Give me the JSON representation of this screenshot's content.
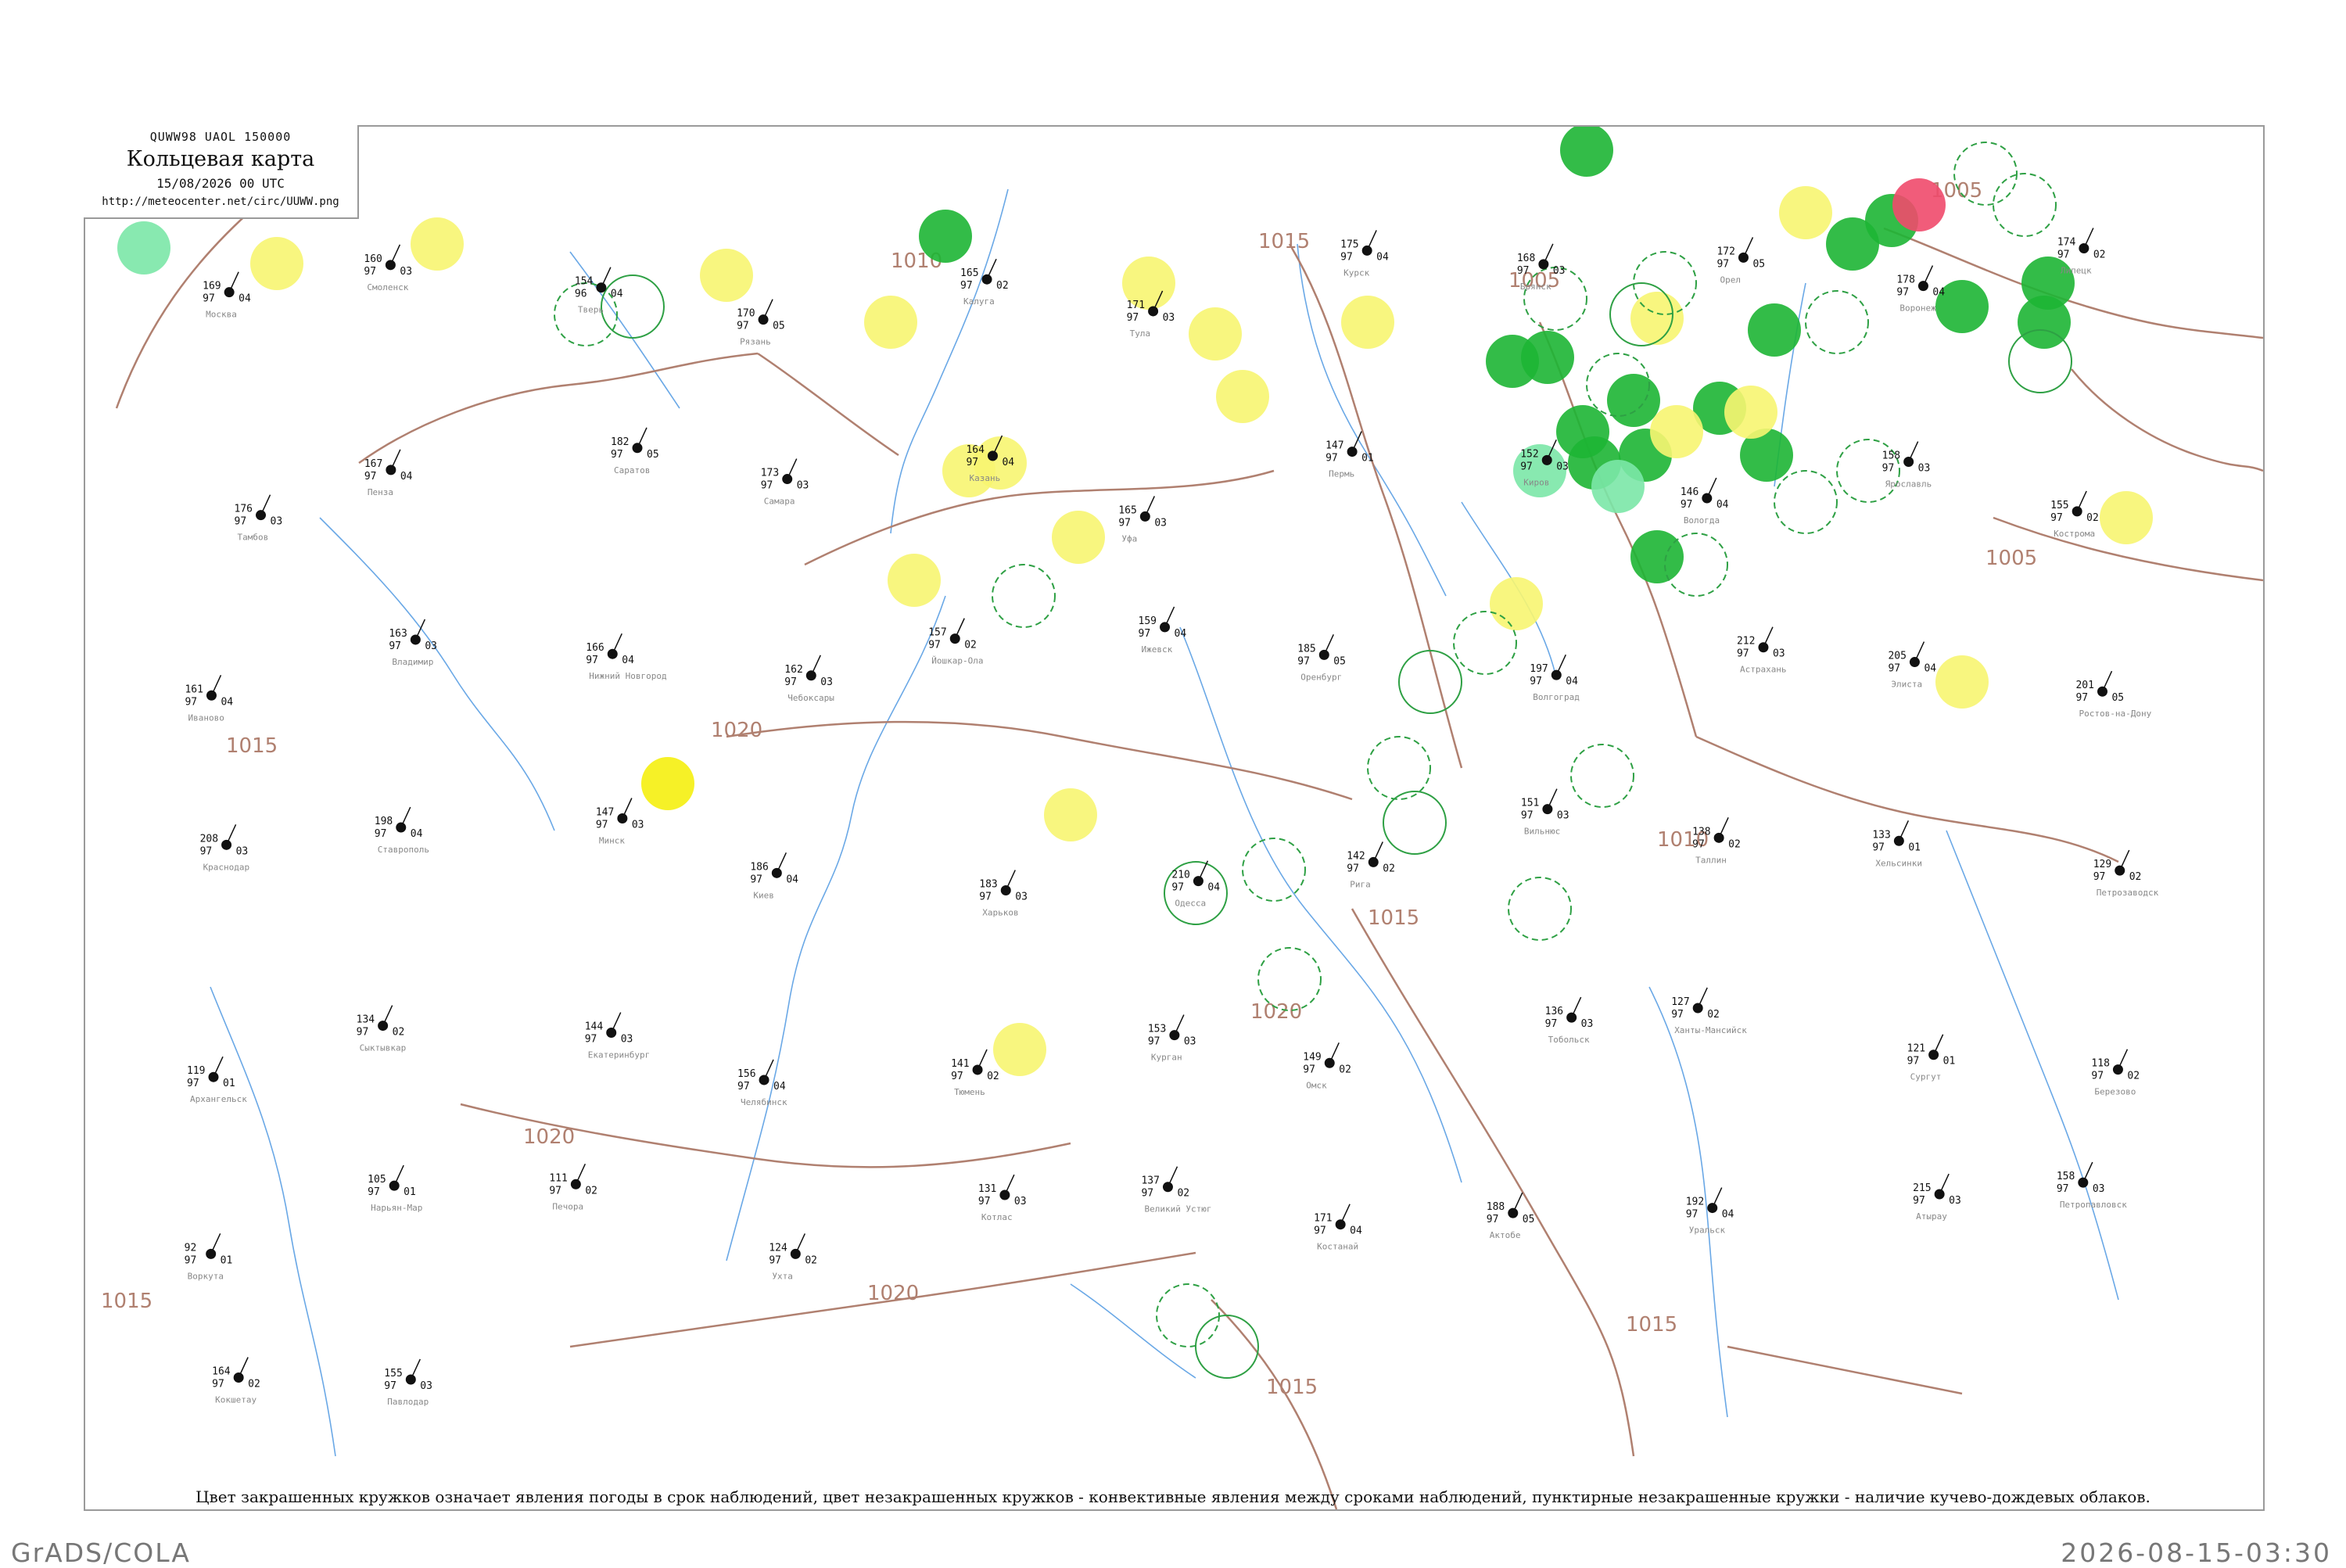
{
  "header": {
    "code": "QUWW98  UAOL  150000",
    "title": "Кольцевая карта",
    "date": "15/08/2026 00 UTC",
    "url": "http://meteocenter.net/circ/UUWW.png"
  },
  "legend": "Цвет закрашенных кружков означает явления погоды в срок наблюдений, цвет незакрашенных кружков - конвективные явления между сроками наблюдений, пунктирные незакрашенные кружки - наличие кучево-дождевых облаков.",
  "footer": {
    "left": "GrADS/COLA",
    "right": "2026-08-15-03:30"
  },
  "colors": {
    "green": "#1db534",
    "light_green": "#7be7a7",
    "yellow": "#f7f571",
    "bright_yellow": "#f5ef10",
    "red": "#ef4a6b",
    "isobar": "#b08070",
    "river": "#6aa8e6",
    "conv_ring": "#2ea044"
  },
  "isobar_labels": [
    "1015",
    "1010",
    "1005",
    "1005",
    "1005",
    "1010",
    "1015",
    "1020",
    "1020",
    "1020",
    "1020",
    "1015",
    "1015",
    "1015",
    "1015"
  ],
  "stations": [
    {
      "name": "Москва",
      "t": "169",
      "p": "97",
      "v": "04"
    },
    {
      "name": "Смоленск",
      "t": "160",
      "p": "97",
      "v": "03"
    },
    {
      "name": "Тверь",
      "t": "154",
      "p": "96",
      "v": "04"
    },
    {
      "name": "Рязань",
      "t": "170",
      "p": "97",
      "v": "05"
    },
    {
      "name": "Калуга",
      "t": "165",
      "p": "97",
      "v": "02"
    },
    {
      "name": "Тула",
      "t": "171",
      "p": "97",
      "v": "03"
    },
    {
      "name": "Курск",
      "t": "175",
      "p": "97",
      "v": "04"
    },
    {
      "name": "Брянск",
      "t": "168",
      "p": "97",
      "v": "03"
    },
    {
      "name": "Орел",
      "t": "172",
      "p": "97",
      "v": "05"
    },
    {
      "name": "Воронеж",
      "t": "178",
      "p": "97",
      "v": "04"
    },
    {
      "name": "Липецк",
      "t": "174",
      "p": "97",
      "v": "02"
    },
    {
      "name": "Тамбов",
      "t": "176",
      "p": "97",
      "v": "03"
    },
    {
      "name": "Пенза",
      "t": "167",
      "p": "97",
      "v": "04"
    },
    {
      "name": "Саратов",
      "t": "182",
      "p": "97",
      "v": "05"
    },
    {
      "name": "Самара",
      "t": "173",
      "p": "97",
      "v": "03"
    },
    {
      "name": "Казань",
      "t": "164",
      "p": "97",
      "v": "04"
    },
    {
      "name": "Уфа",
      "t": "165",
      "p": "97",
      "v": "03"
    },
    {
      "name": "Пермь",
      "t": "147",
      "p": "97",
      "v": "01"
    },
    {
      "name": "Киров",
      "t": "152",
      "p": "97",
      "v": "03"
    },
    {
      "name": "Вологда",
      "t": "146",
      "p": "97",
      "v": "04"
    },
    {
      "name": "Ярославль",
      "t": "158",
      "p": "97",
      "v": "03"
    },
    {
      "name": "Кострома",
      "t": "155",
      "p": "97",
      "v": "02"
    },
    {
      "name": "Иваново",
      "t": "161",
      "p": "97",
      "v": "04"
    },
    {
      "name": "Владимир",
      "t": "163",
      "p": "97",
      "v": "03"
    },
    {
      "name": "Нижний Новгород",
      "t": "166",
      "p": "97",
      "v": "04"
    },
    {
      "name": "Чебоксары",
      "t": "162",
      "p": "97",
      "v": "03"
    },
    {
      "name": "Йошкар-Ола",
      "t": "157",
      "p": "97",
      "v": "02"
    },
    {
      "name": "Ижевск",
      "t": "159",
      "p": "97",
      "v": "04"
    },
    {
      "name": "Оренбург",
      "t": "185",
      "p": "97",
      "v": "05"
    },
    {
      "name": "Волгоград",
      "t": "197",
      "p": "97",
      "v": "04"
    },
    {
      "name": "Астрахань",
      "t": "212",
      "p": "97",
      "v": "03"
    },
    {
      "name": "Элиста",
      "t": "205",
      "p": "97",
      "v": "04"
    },
    {
      "name": "Ростов-на-Дону",
      "t": "201",
      "p": "97",
      "v": "05"
    },
    {
      "name": "Краснодар",
      "t": "208",
      "p": "97",
      "v": "03"
    },
    {
      "name": "Ставрополь",
      "t": "198",
      "p": "97",
      "v": "04"
    },
    {
      "name": "Минск",
      "t": "147",
      "p": "97",
      "v": "03"
    },
    {
      "name": "Киев",
      "t": "186",
      "p": "97",
      "v": "04"
    },
    {
      "name": "Харьков",
      "t": "183",
      "p": "97",
      "v": "03"
    },
    {
      "name": "Одесса",
      "t": "210",
      "p": "97",
      "v": "04"
    },
    {
      "name": "Рига",
      "t": "142",
      "p": "97",
      "v": "02"
    },
    {
      "name": "Вильнюс",
      "t": "151",
      "p": "97",
      "v": "03"
    },
    {
      "name": "Таллин",
      "t": "138",
      "p": "97",
      "v": "02"
    },
    {
      "name": "Хельсинки",
      "t": "133",
      "p": "97",
      "v": "01"
    },
    {
      "name": "Петрозаводск",
      "t": "129",
      "p": "97",
      "v": "02"
    },
    {
      "name": "Архангельск",
      "t": "119",
      "p": "97",
      "v": "01"
    },
    {
      "name": "Сыктывкар",
      "t": "134",
      "p": "97",
      "v": "02"
    },
    {
      "name": "Екатеринбург",
      "t": "144",
      "p": "97",
      "v": "03"
    },
    {
      "name": "Челябинск",
      "t": "156",
      "p": "97",
      "v": "04"
    },
    {
      "name": "Тюмень",
      "t": "141",
      "p": "97",
      "v": "02"
    },
    {
      "name": "Курган",
      "t": "153",
      "p": "97",
      "v": "03"
    },
    {
      "name": "Омск",
      "t": "149",
      "p": "97",
      "v": "02"
    },
    {
      "name": "Тобольск",
      "t": "136",
      "p": "97",
      "v": "03"
    },
    {
      "name": "Ханты-Мансийск",
      "t": "127",
      "p": "97",
      "v": "02"
    },
    {
      "name": "Сургут",
      "t": "121",
      "p": "97",
      "v": "01"
    },
    {
      "name": "Березово",
      "t": "118",
      "p": "97",
      "v": "02"
    },
    {
      "name": "Воркута",
      "t": "92",
      "p": "97",
      "v": "01"
    },
    {
      "name": "Нарьян-Мар",
      "t": "105",
      "p": "97",
      "v": "01"
    },
    {
      "name": "Печора",
      "t": "111",
      "p": "97",
      "v": "02"
    },
    {
      "name": "Ухта",
      "t": "124",
      "p": "97",
      "v": "02"
    },
    {
      "name": "Котлас",
      "t": "131",
      "p": "97",
      "v": "03"
    },
    {
      "name": "Великий Устюг",
      "t": "137",
      "p": "97",
      "v": "02"
    },
    {
      "name": "Костанай",
      "t": "171",
      "p": "97",
      "v": "04"
    },
    {
      "name": "Актобе",
      "t": "188",
      "p": "97",
      "v": "05"
    },
    {
      "name": "Уральск",
      "t": "192",
      "p": "97",
      "v": "04"
    },
    {
      "name": "Атырау",
      "t": "215",
      "p": "97",
      "v": "03"
    },
    {
      "name": "Петропавловск",
      "t": "158",
      "p": "97",
      "v": "03"
    },
    {
      "name": "Кокшетау",
      "t": "164",
      "p": "97",
      "v": "02"
    },
    {
      "name": "Павлодар",
      "t": "155",
      "p": "97",
      "v": "03"
    }
  ]
}
